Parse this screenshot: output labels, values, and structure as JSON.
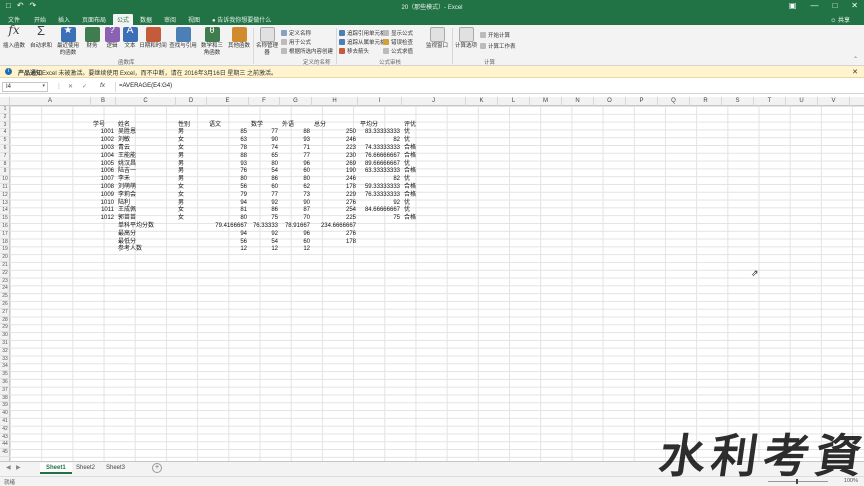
{
  "window": {
    "title": "20（那些模式）- Excel",
    "colors": {
      "brand": "#217346",
      "message_bar": "#fff4ce"
    },
    "qat_icons": [
      "save-icon",
      "undo-icon",
      "redo-icon"
    ]
  },
  "tabs": [
    "文件",
    "开始",
    "插入",
    "页面布局",
    "公式",
    "数据",
    "审阅",
    "视图"
  ],
  "active_tab": "公式",
  "tellme": "告诉我你想要做什么",
  "share": "共享",
  "ribbon": {
    "buttons": [
      {
        "label": "插入函数",
        "icon": "fx-icon"
      },
      {
        "label": "自动求和",
        "icon": "sum-icon"
      },
      {
        "label": "最近使用的函数",
        "icon": "star-icon"
      },
      {
        "label": "财务",
        "icon": "book-icon"
      },
      {
        "label": "逻辑",
        "icon": "question-icon"
      },
      {
        "label": "文本",
        "icon": "text-icon"
      },
      {
        "label": "日期和时间",
        "icon": "calendar-icon"
      },
      {
        "label": "查找与引用",
        "icon": "lookup-icon"
      },
      {
        "label": "数学和三角函数",
        "icon": "math-icon"
      },
      {
        "label": "其他函数",
        "icon": "more-icon"
      },
      {
        "label": "名称管理器",
        "icon": "name-manager-icon"
      },
      {
        "label": "监视窗口",
        "icon": "watch-icon"
      },
      {
        "label": "计算选项",
        "icon": "calc-options-icon"
      }
    ],
    "small": [
      "定义名称",
      "用于公式",
      "根据所选内容创建",
      "追踪引用单元格",
      "追踪从属单元格",
      "移去箭头",
      "显示公式",
      "错误检查",
      "公式求值",
      "开始计算",
      "计算工作表"
    ],
    "groups": [
      "函数库",
      "定义的名称",
      "公式审核",
      "计算"
    ]
  },
  "message_bar": {
    "bold": "产品通知",
    "text": "Excel 未被激活。要继续使用 Excel，而不中断，请在 2016年3月16日 星期三 之前激活。"
  },
  "formula_bar": {
    "name_box": "I4",
    "formula": "=AVERAGE(E4:G4)"
  },
  "columns": [
    "A",
    "B",
    "C",
    "D",
    "E",
    "F",
    "G",
    "H",
    "I",
    "J",
    "K",
    "L",
    "M",
    "N",
    "O",
    "P",
    "Q",
    "R",
    "S",
    "T",
    "U",
    "V"
  ],
  "row_count": 45,
  "cells": [
    {
      "r": 3,
      "c": "B",
      "v": "学号"
    },
    {
      "r": 3,
      "c": "C",
      "v": "姓名"
    },
    {
      "r": 3,
      "c": "D",
      "v": "性别"
    },
    {
      "r": 3,
      "c": "E",
      "v": "语文"
    },
    {
      "r": 3,
      "c": "F",
      "v": "数学"
    },
    {
      "r": 3,
      "c": "G",
      "v": "外语"
    },
    {
      "r": 3,
      "c": "H",
      "v": "总分"
    },
    {
      "r": 3,
      "c": "I",
      "v": "平均分"
    },
    {
      "r": 3,
      "c": "J",
      "v": "评优"
    },
    {
      "r": 4,
      "c": "B",
      "v": "1001",
      "n": 1
    },
    {
      "r": 4,
      "c": "C",
      "v": "吴胜恩"
    },
    {
      "r": 4,
      "c": "D",
      "v": "男"
    },
    {
      "r": 4,
      "c": "E",
      "v": "85",
      "n": 1
    },
    {
      "r": 4,
      "c": "F",
      "v": "77",
      "n": 1
    },
    {
      "r": 4,
      "c": "G",
      "v": "88",
      "n": 1
    },
    {
      "r": 4,
      "c": "H",
      "v": "250",
      "n": 1
    },
    {
      "r": 4,
      "c": "I",
      "v": "83.33333333",
      "n": 1
    },
    {
      "r": 4,
      "c": "J",
      "v": "优"
    },
    {
      "r": 5,
      "c": "B",
      "v": "1002",
      "n": 1
    },
    {
      "r": 5,
      "c": "C",
      "v": "刘敏"
    },
    {
      "r": 5,
      "c": "D",
      "v": "女"
    },
    {
      "r": 5,
      "c": "E",
      "v": "63",
      "n": 1
    },
    {
      "r": 5,
      "c": "F",
      "v": "90",
      "n": 1
    },
    {
      "r": 5,
      "c": "G",
      "v": "93",
      "n": 1
    },
    {
      "r": 5,
      "c": "H",
      "v": "246",
      "n": 1
    },
    {
      "r": 5,
      "c": "I",
      "v": "82",
      "n": 1
    },
    {
      "r": 5,
      "c": "J",
      "v": "优"
    },
    {
      "r": 6,
      "c": "B",
      "v": "1003",
      "n": 1
    },
    {
      "r": 6,
      "c": "C",
      "v": "青云"
    },
    {
      "r": 6,
      "c": "D",
      "v": "女"
    },
    {
      "r": 6,
      "c": "E",
      "v": "78",
      "n": 1
    },
    {
      "r": 6,
      "c": "F",
      "v": "74",
      "n": 1
    },
    {
      "r": 6,
      "c": "G",
      "v": "71",
      "n": 1
    },
    {
      "r": 6,
      "c": "H",
      "v": "223",
      "n": 1
    },
    {
      "r": 6,
      "c": "I",
      "v": "74.33333333",
      "n": 1
    },
    {
      "r": 6,
      "c": "J",
      "v": "合格"
    },
    {
      "r": 7,
      "c": "B",
      "v": "1004",
      "n": 1
    },
    {
      "r": 7,
      "c": "C",
      "v": "王能能"
    },
    {
      "r": 7,
      "c": "D",
      "v": "男"
    },
    {
      "r": 7,
      "c": "E",
      "v": "88",
      "n": 1
    },
    {
      "r": 7,
      "c": "F",
      "v": "65",
      "n": 1
    },
    {
      "r": 7,
      "c": "G",
      "v": "77",
      "n": 1
    },
    {
      "r": 7,
      "c": "H",
      "v": "230",
      "n": 1
    },
    {
      "r": 7,
      "c": "I",
      "v": "76.66666667",
      "n": 1
    },
    {
      "r": 7,
      "c": "J",
      "v": "合格"
    },
    {
      "r": 8,
      "c": "B",
      "v": "1005",
      "n": 1
    },
    {
      "r": 8,
      "c": "C",
      "v": "姚汉昌"
    },
    {
      "r": 8,
      "c": "D",
      "v": "男"
    },
    {
      "r": 8,
      "c": "E",
      "v": "93",
      "n": 1
    },
    {
      "r": 8,
      "c": "F",
      "v": "80",
      "n": 1
    },
    {
      "r": 8,
      "c": "G",
      "v": "96",
      "n": 1
    },
    {
      "r": 8,
      "c": "H",
      "v": "269",
      "n": 1
    },
    {
      "r": 8,
      "c": "I",
      "v": "89.66666667",
      "n": 1
    },
    {
      "r": 8,
      "c": "J",
      "v": "优"
    },
    {
      "r": 9,
      "c": "B",
      "v": "1006",
      "n": 1
    },
    {
      "r": 9,
      "c": "C",
      "v": "陆吉一"
    },
    {
      "r": 9,
      "c": "D",
      "v": "男"
    },
    {
      "r": 9,
      "c": "E",
      "v": "76",
      "n": 1
    },
    {
      "r": 9,
      "c": "F",
      "v": "54",
      "n": 1
    },
    {
      "r": 9,
      "c": "G",
      "v": "60",
      "n": 1
    },
    {
      "r": 9,
      "c": "H",
      "v": "190",
      "n": 1
    },
    {
      "r": 9,
      "c": "I",
      "v": "63.33333333",
      "n": 1
    },
    {
      "r": 9,
      "c": "J",
      "v": "合格"
    },
    {
      "r": 10,
      "c": "B",
      "v": "1007",
      "n": 1
    },
    {
      "r": 10,
      "c": "C",
      "v": "李禾"
    },
    {
      "r": 10,
      "c": "D",
      "v": "男"
    },
    {
      "r": 10,
      "c": "E",
      "v": "80",
      "n": 1
    },
    {
      "r": 10,
      "c": "F",
      "v": "86",
      "n": 1
    },
    {
      "r": 10,
      "c": "G",
      "v": "80",
      "n": 1
    },
    {
      "r": 10,
      "c": "H",
      "v": "246",
      "n": 1
    },
    {
      "r": 10,
      "c": "I",
      "v": "82",
      "n": 1
    },
    {
      "r": 10,
      "c": "J",
      "v": "优"
    },
    {
      "r": 11,
      "c": "B",
      "v": "1008",
      "n": 1
    },
    {
      "r": 11,
      "c": "C",
      "v": "刘萌萌"
    },
    {
      "r": 11,
      "c": "D",
      "v": "女"
    },
    {
      "r": 11,
      "c": "E",
      "v": "56",
      "n": 1
    },
    {
      "r": 11,
      "c": "F",
      "v": "60",
      "n": 1
    },
    {
      "r": 11,
      "c": "G",
      "v": "62",
      "n": 1
    },
    {
      "r": 11,
      "c": "H",
      "v": "178",
      "n": 1
    },
    {
      "r": 11,
      "c": "I",
      "v": "59.33333333",
      "n": 1
    },
    {
      "r": 11,
      "c": "J",
      "v": "合格"
    },
    {
      "r": 12,
      "c": "B",
      "v": "1009",
      "n": 1
    },
    {
      "r": 12,
      "c": "C",
      "v": "李莉会"
    },
    {
      "r": 12,
      "c": "D",
      "v": "女"
    },
    {
      "r": 12,
      "c": "E",
      "v": "79",
      "n": 1
    },
    {
      "r": 12,
      "c": "F",
      "v": "77",
      "n": 1
    },
    {
      "r": 12,
      "c": "G",
      "v": "73",
      "n": 1
    },
    {
      "r": 12,
      "c": "H",
      "v": "229",
      "n": 1
    },
    {
      "r": 12,
      "c": "I",
      "v": "76.33333333",
      "n": 1
    },
    {
      "r": 12,
      "c": "J",
      "v": "合格"
    },
    {
      "r": 13,
      "c": "B",
      "v": "1010",
      "n": 1
    },
    {
      "r": 13,
      "c": "C",
      "v": "陆利"
    },
    {
      "r": 13,
      "c": "D",
      "v": "男"
    },
    {
      "r": 13,
      "c": "E",
      "v": "94",
      "n": 1
    },
    {
      "r": 13,
      "c": "F",
      "v": "92",
      "n": 1
    },
    {
      "r": 13,
      "c": "G",
      "v": "90",
      "n": 1
    },
    {
      "r": 13,
      "c": "H",
      "v": "276",
      "n": 1
    },
    {
      "r": 13,
      "c": "I",
      "v": "92",
      "n": 1
    },
    {
      "r": 13,
      "c": "J",
      "v": "优"
    },
    {
      "r": 14,
      "c": "B",
      "v": "1011",
      "n": 1
    },
    {
      "r": 14,
      "c": "C",
      "v": "王成佩"
    },
    {
      "r": 14,
      "c": "D",
      "v": "女"
    },
    {
      "r": 14,
      "c": "E",
      "v": "81",
      "n": 1
    },
    {
      "r": 14,
      "c": "F",
      "v": "86",
      "n": 1
    },
    {
      "r": 14,
      "c": "G",
      "v": "87",
      "n": 1
    },
    {
      "r": 14,
      "c": "H",
      "v": "254",
      "n": 1
    },
    {
      "r": 14,
      "c": "I",
      "v": "84.66666667",
      "n": 1
    },
    {
      "r": 14,
      "c": "J",
      "v": "优"
    },
    {
      "r": 15,
      "c": "B",
      "v": "1012",
      "n": 1
    },
    {
      "r": 15,
      "c": "C",
      "v": "郭苗苗"
    },
    {
      "r": 15,
      "c": "D",
      "v": "女"
    },
    {
      "r": 15,
      "c": "E",
      "v": "80",
      "n": 1
    },
    {
      "r": 15,
      "c": "F",
      "v": "75",
      "n": 1
    },
    {
      "r": 15,
      "c": "G",
      "v": "70",
      "n": 1
    },
    {
      "r": 15,
      "c": "H",
      "v": "225",
      "n": 1
    },
    {
      "r": 15,
      "c": "I",
      "v": "75",
      "n": 1
    },
    {
      "r": 15,
      "c": "J",
      "v": "合格"
    },
    {
      "r": 16,
      "c": "C",
      "v": "单科平均分数"
    },
    {
      "r": 16,
      "c": "E",
      "v": "79.4166667",
      "n": 1
    },
    {
      "r": 16,
      "c": "F",
      "v": "76.33333",
      "n": 1
    },
    {
      "r": 16,
      "c": "G",
      "v": "78.91667",
      "n": 1
    },
    {
      "r": 16,
      "c": "H",
      "v": "234.6666667",
      "n": 1
    },
    {
      "r": 17,
      "c": "C",
      "v": "最高分"
    },
    {
      "r": 17,
      "c": "E",
      "v": "94",
      "n": 1
    },
    {
      "r": 17,
      "c": "F",
      "v": "92",
      "n": 1
    },
    {
      "r": 17,
      "c": "G",
      "v": "96",
      "n": 1
    },
    {
      "r": 17,
      "c": "H",
      "v": "276",
      "n": 1
    },
    {
      "r": 18,
      "c": "C",
      "v": "最低分"
    },
    {
      "r": 18,
      "c": "E",
      "v": "56",
      "n": 1
    },
    {
      "r": 18,
      "c": "F",
      "v": "54",
      "n": 1
    },
    {
      "r": 18,
      "c": "G",
      "v": "60",
      "n": 1
    },
    {
      "r": 18,
      "c": "H",
      "v": "178",
      "n": 1
    },
    {
      "r": 19,
      "c": "C",
      "v": "参考人数"
    },
    {
      "r": 19,
      "c": "E",
      "v": "12",
      "n": 1
    },
    {
      "r": 19,
      "c": "F",
      "v": "12",
      "n": 1
    },
    {
      "r": 19,
      "c": "G",
      "v": "12",
      "n": 1
    }
  ],
  "sheets": [
    "Sheet1",
    "Sheet2",
    "Sheet3"
  ],
  "active_sheet": "Sheet1",
  "status": {
    "ready": "就绪",
    "zoom": "100%"
  },
  "watermark": "水利考資"
}
